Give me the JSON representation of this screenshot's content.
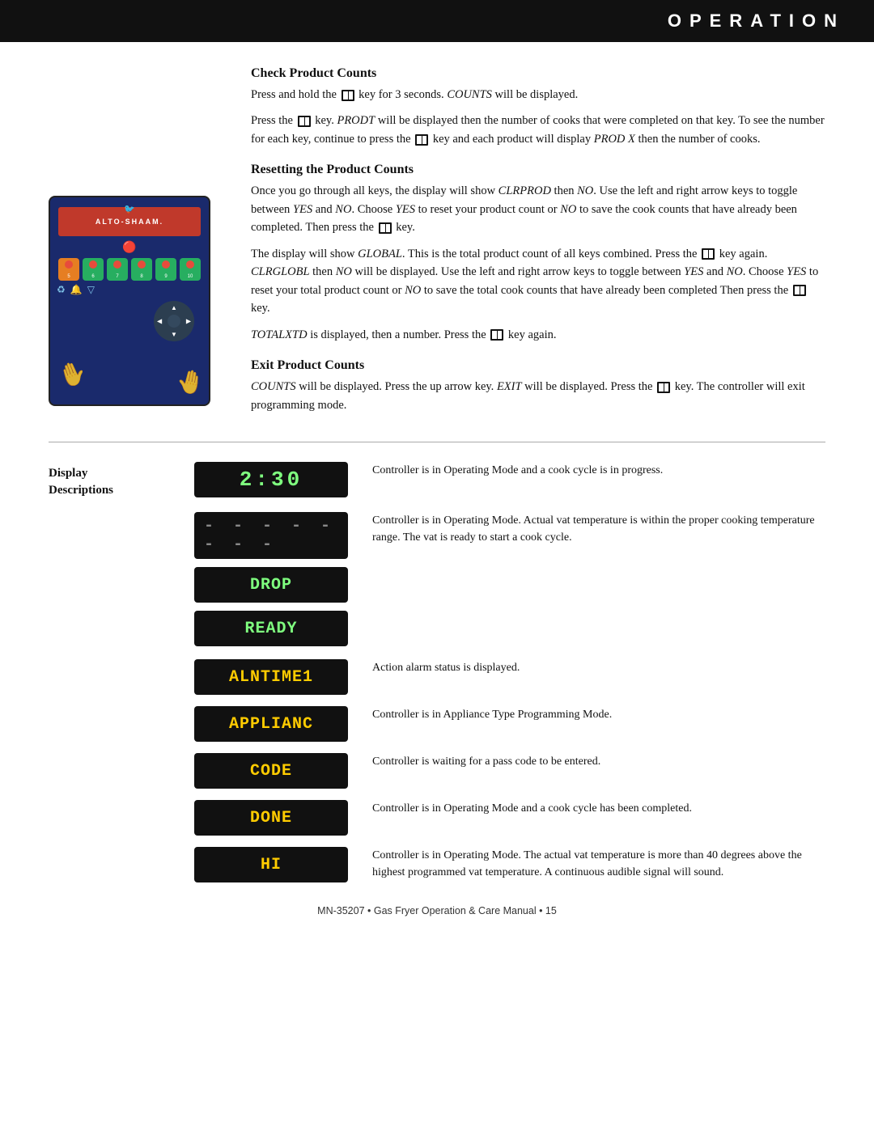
{
  "header": {
    "title": "OPERATION",
    "bg_color": "#111"
  },
  "sections": {
    "check_product_counts": {
      "heading": "Check Product Counts",
      "para1": "Press and hold the",
      "para1_key": "⊞",
      "para1_cont": "key for 3 seconds.",
      "para1_italic": "COUNTS",
      "para1_end": "will be displayed.",
      "para2_start": "Press the",
      "para2_italic1": "PRODT",
      "para2_mid": "will be displayed then the number of cooks that were completed on that key. To see the number for each key, continue to press the",
      "para2_mid2": "key and each product will display",
      "para2_italic2": "PROD X",
      "para2_end": "then the number of cooks."
    },
    "resetting_product_counts": {
      "heading": "Resetting the Product Counts",
      "para1_start": "Once you go through all keys, the display will show",
      "para1_italic1": "CLRPROD",
      "para1_mid": "then",
      "para1_italic2": "NO",
      "para1_mid2": ". Use the left and right arrow keys to toggle between",
      "para1_italic3": "YES",
      "para1_mid3": "and",
      "para1_italic4": "NO",
      "para1_mid4": ". Choose",
      "para1_italic5": "YES",
      "para1_mid5": "to reset your product count or",
      "para1_italic6": "NO",
      "para1_end": "to save the cook counts that have already been completed.  Then press the",
      "para1_key_end": "⊞",
      "para1_key_label": "key.",
      "para2_start": "The display will show",
      "para2_italic1": "GLOBAL",
      "para2_mid": ". This is the total product count of all keys combined. Press the",
      "para2_key": "⊞",
      "para2_mid2": "key again.",
      "para2_italic2": "CLRGLOBL",
      "para2_mid3": "then",
      "para2_italic3": "NO",
      "para2_mid4": "will be displayed. Use the left and right arrow keys to toggle between",
      "para2_italic4": "YES",
      "para2_mid5": "and",
      "para2_italic5": "NO",
      "para2_mid6": ". Choose",
      "para2_italic6": "YES",
      "para2_mid7": "to reset your total product count or",
      "para2_italic7": "NO",
      "para2_end": "to save the total cook counts that have already been completed Then press the",
      "para2_key_end": "⊞",
      "para2_key_label": "key.",
      "para3_italic": "TOTALXTD",
      "para3_mid": "is displayed, then a number. Press the",
      "para3_key": "⊞",
      "para3_end": "key again."
    },
    "exit_product_counts": {
      "heading": "Exit Product Counts",
      "para1_italic": "COUNTS",
      "para1_mid": "will be displayed. Press the up arrow key.",
      "para1_italic2": "EXIT",
      "para1_mid2": "will be displayed.  Press the",
      "para1_key": "⊞",
      "para1_end": "key. The controller will exit programming mode."
    }
  },
  "display_section": {
    "label_line1": "Display",
    "label_line2": "Descriptions",
    "displays": [
      {
        "text": "2:30",
        "style": "time",
        "description": "Controller is in Operating Mode and a cook cycle is in progress."
      },
      {
        "text": "- - - - - - - -",
        "style": "dashes",
        "description": "Controller is in Operating Mode. Actual vat temperature is within the proper cooking temperature range. The vat is ready to start a cook cycle."
      },
      {
        "text": "DROP",
        "style": "green",
        "description": ""
      },
      {
        "text": "READY",
        "style": "green",
        "description": ""
      },
      {
        "text": "ALNTIME1",
        "style": "amber",
        "description": "Action alarm status is displayed."
      },
      {
        "text": "APPLIANC",
        "style": "amber",
        "description": "Controller is in Appliance Type Programming Mode."
      },
      {
        "text": "CODE",
        "style": "amber",
        "description": "Controller is waiting for a pass code to be entered."
      },
      {
        "text": "DONE",
        "style": "amber",
        "description": "Controller is in Operating Mode and a cook cycle has been completed."
      },
      {
        "text": "HI",
        "style": "amber",
        "description": "Controller is in Operating Mode. The actual vat temperature is more than 40 degrees above the highest programmed vat temperature. A continuous audible signal will sound."
      }
    ]
  },
  "footer": {
    "text": "MN-35207 • Gas Fryer Operation & Care Manual • 15"
  }
}
